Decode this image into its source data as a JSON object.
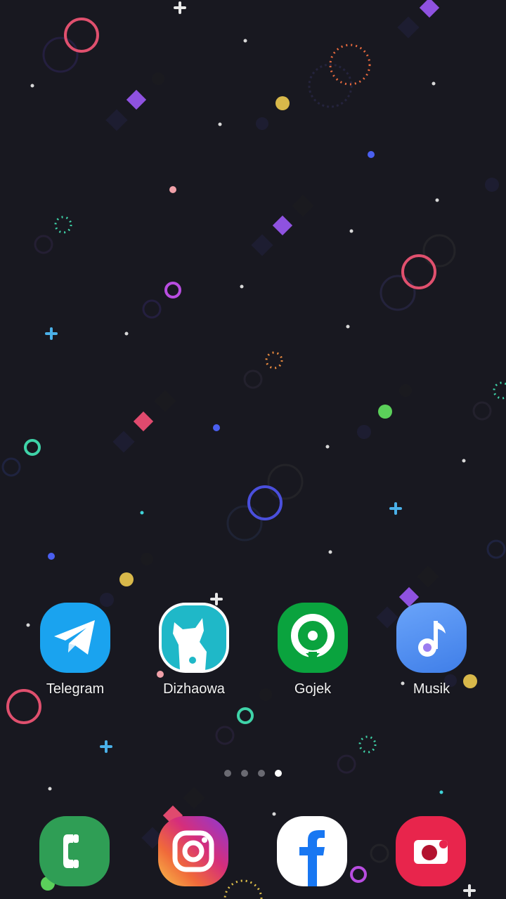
{
  "home": {
    "apps": [
      {
        "label": "Telegram",
        "icon": "telegram-icon",
        "color": "#1aa3ef"
      },
      {
        "label": "Dizhaowa",
        "icon": "dizhaowa-cat-icon",
        "color": "#1fb8c8"
      },
      {
        "label": "Gojek",
        "icon": "gojek-icon",
        "color": "#0aa33e"
      },
      {
        "label": "Musik",
        "icon": "music-note-icon",
        "color": "#4f8ff2"
      }
    ],
    "page_indicator": {
      "count": 4,
      "active_index": 3
    }
  },
  "dock": {
    "apps": [
      {
        "icon": "phone-icon",
        "color": "#2f9e55"
      },
      {
        "icon": "instagram-icon",
        "color": "#d62e7a"
      },
      {
        "icon": "facebook-icon",
        "color": "#1877f2"
      },
      {
        "icon": "camera-icon",
        "color": "#e8254c"
      }
    ]
  }
}
